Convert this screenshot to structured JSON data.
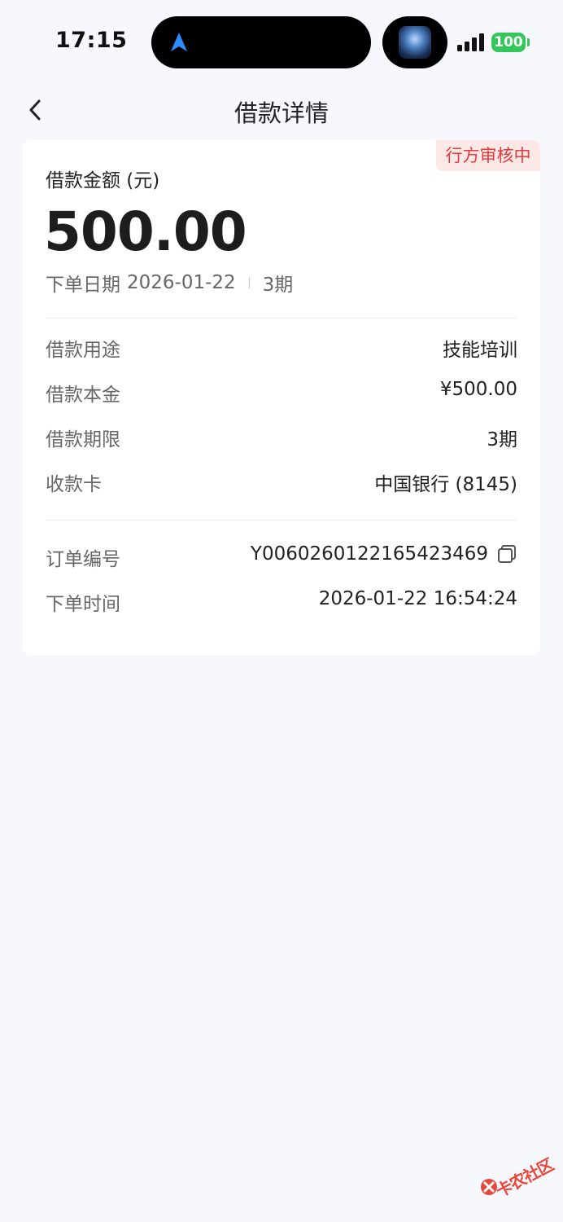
{
  "status_bar": {
    "time": "17:15",
    "battery": "100"
  },
  "header": {
    "title": "借款详情"
  },
  "card": {
    "status_badge": "行方审核中",
    "amount_label": "借款金额 (元)",
    "amount_value": "500.00",
    "order_date_label": "下单日期",
    "order_date": "2026-01-22",
    "term_short": "3期",
    "rows": [
      {
        "label": "借款用途",
        "value": "技能培训"
      },
      {
        "label": "借款本金",
        "value": "¥500.00"
      },
      {
        "label": "借款期限",
        "value": "3期"
      },
      {
        "label": "收款卡",
        "value": "中国银行 (8145)"
      }
    ],
    "order_rows": [
      {
        "label": "订单编号",
        "value": "Y006026012216542346​9"
      },
      {
        "label": "下单时间",
        "value": "2026-01-22 16:54:24"
      }
    ]
  },
  "watermark": {
    "text": "卡农社区"
  },
  "colors": {
    "background": "#f6f8fd",
    "card": "#ffffff",
    "badge_text": "#e33a3a",
    "badge_bg": "#fde8e8",
    "battery": "#33c759"
  }
}
